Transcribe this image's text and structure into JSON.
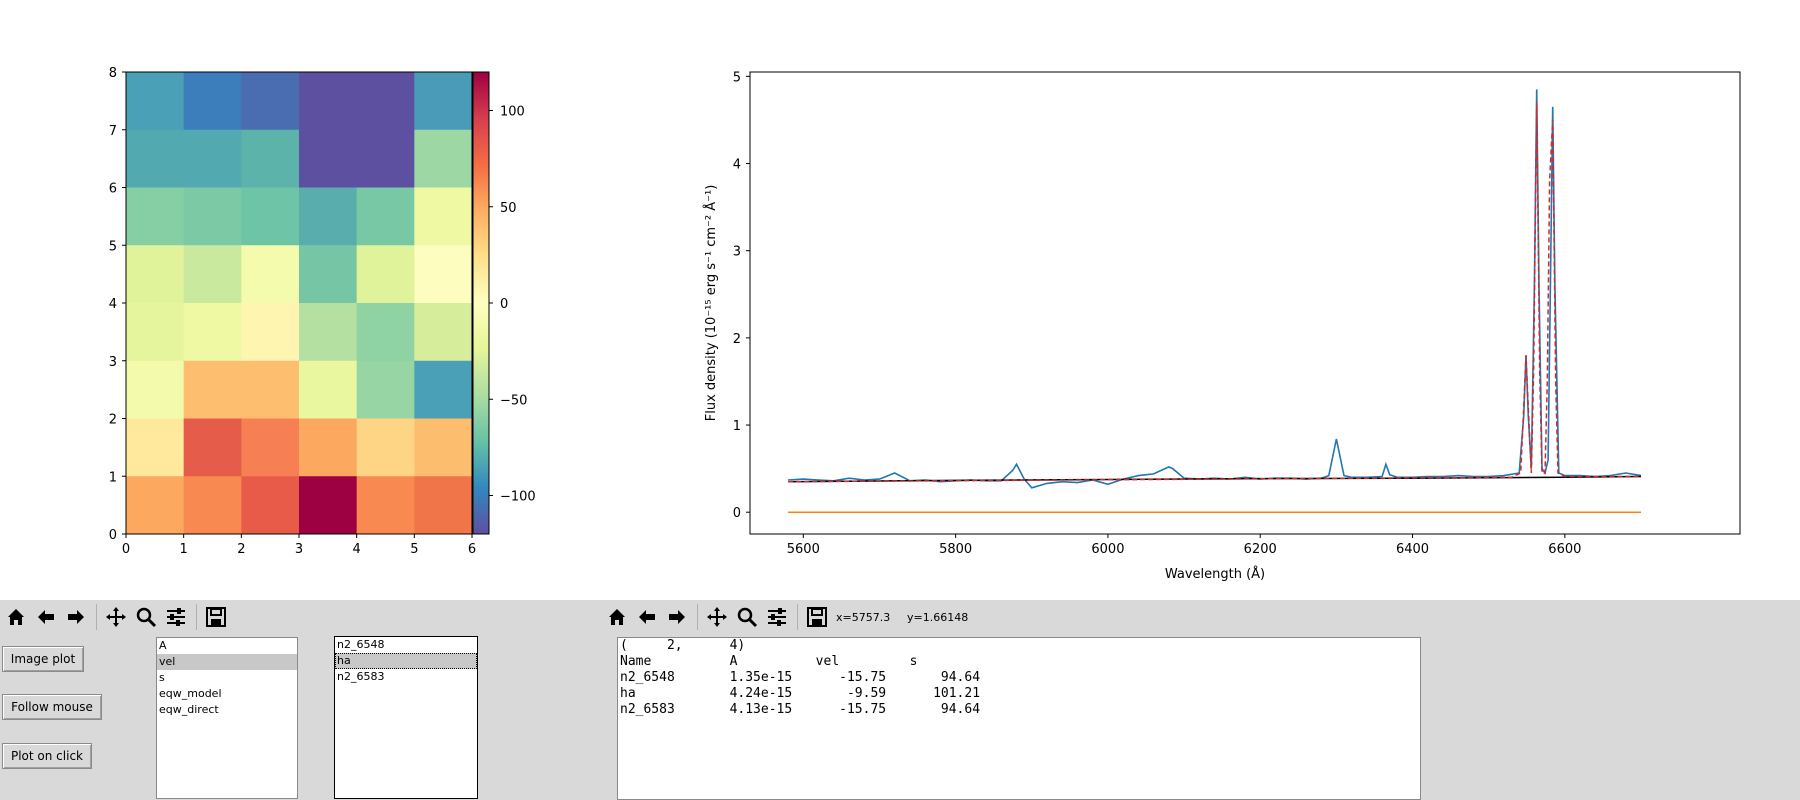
{
  "heatmap": {
    "xticks": [
      "0",
      "1",
      "2",
      "3",
      "4",
      "5",
      "6"
    ],
    "yticks": [
      "0",
      "1",
      "2",
      "3",
      "4",
      "5",
      "6",
      "7",
      "8"
    ],
    "colorbar_ticks": [
      "100",
      "50",
      "0",
      "−50",
      "−100"
    ],
    "colorbar_tick_values": [
      100,
      50,
      0,
      -50,
      -100
    ],
    "vmin": -120,
    "vmax": 120,
    "rows_top_to_bottom": [
      [
        "#4aa0b6",
        "#3b7ebb",
        "#4a6cb0",
        "#5e50a1",
        "#5e50a1",
        "#4a9bb8"
      ],
      [
        "#52a9af",
        "#52a9af",
        "#5cb3aa",
        "#5e50a1",
        "#5e50a1",
        "#9cd7a4"
      ],
      [
        "#86cfa5",
        "#7ccaa5",
        "#6ec4a6",
        "#5aadad",
        "#78c8a5",
        "#eff9a4"
      ],
      [
        "#e0f39a",
        "#c8e99e",
        "#f5fbac",
        "#76c6a5",
        "#e0f39a",
        "#fcfdbf"
      ],
      [
        "#e5f59e",
        "#eff9a4",
        "#fef5b0",
        "#b4e1a2",
        "#8fd3a4",
        "#d6ee9b"
      ],
      [
        "#f3faac",
        "#fdbe70",
        "#fdbe70",
        "#e9f79e",
        "#97d6a4",
        "#4aa0b6"
      ],
      [
        "#fee99d",
        "#e55d4a",
        "#f67f53",
        "#fca85e",
        "#fed585",
        "#fdbd6f"
      ],
      [
        "#fca85e",
        "#f88950",
        "#e85b48",
        "#9e0142",
        "#f88950",
        "#f07548"
      ]
    ]
  },
  "spectrum": {
    "xlabel": "Wavelength (Å)",
    "ylabel": "Flux density (10⁻¹⁵ erg s⁻¹ cm⁻² Å⁻¹)",
    "xticks": [
      "5600",
      "5800",
      "6000",
      "6200",
      "6400",
      "6600"
    ],
    "yticks": [
      "0",
      "1",
      "2",
      "3",
      "4",
      "5"
    ],
    "chart_data": {
      "type": "line",
      "xlabel": "Wavelength (Å)",
      "ylabel": "Flux density (10⁻¹⁵ erg s⁻¹ cm⁻² Å⁻¹)",
      "xlim": [
        5530,
        6830
      ],
      "ylim": [
        -0.25,
        5.05
      ],
      "series": [
        {
          "style": "observed",
          "color": "#1f77b4",
          "x": [
            5580,
            5600,
            5620,
            5640,
            5660,
            5680,
            5700,
            5720,
            5740,
            5760,
            5780,
            5800,
            5820,
            5840,
            5860,
            5875,
            5880,
            5890,
            5900,
            5920,
            5940,
            5960,
            5980,
            6000,
            6020,
            6040,
            6060,
            6080,
            6085,
            6100,
            6120,
            6140,
            6160,
            6180,
            6200,
            6220,
            6240,
            6260,
            6280,
            6290,
            6300,
            6310,
            6320,
            6340,
            6360,
            6365,
            6370,
            6380,
            6400,
            6420,
            6440,
            6460,
            6480,
            6500,
            6520,
            6540,
            6546,
            6549,
            6552,
            6556,
            6560,
            6563,
            6566,
            6570,
            6574,
            6578,
            6581,
            6584,
            6587,
            6592,
            6600,
            6620,
            6640,
            6660,
            6680,
            6700
          ],
          "y": [
            0.37,
            0.38,
            0.37,
            0.36,
            0.39,
            0.37,
            0.38,
            0.45,
            0.36,
            0.37,
            0.35,
            0.36,
            0.37,
            0.36,
            0.36,
            0.48,
            0.55,
            0.38,
            0.28,
            0.33,
            0.35,
            0.34,
            0.37,
            0.32,
            0.38,
            0.42,
            0.44,
            0.52,
            0.5,
            0.39,
            0.38,
            0.39,
            0.38,
            0.4,
            0.38,
            0.39,
            0.39,
            0.38,
            0.39,
            0.42,
            0.84,
            0.42,
            0.4,
            0.4,
            0.41,
            0.55,
            0.43,
            0.4,
            0.4,
            0.41,
            0.41,
            0.42,
            0.41,
            0.41,
            0.42,
            0.45,
            1.1,
            1.8,
            1.1,
            0.5,
            2.6,
            4.85,
            2.6,
            0.5,
            0.45,
            0.6,
            2.6,
            4.65,
            2.6,
            0.45,
            0.42,
            0.42,
            0.41,
            0.42,
            0.45,
            0.42
          ]
        },
        {
          "style": "continuum",
          "color": "#000000",
          "x": [
            5580,
            5800,
            6000,
            6200,
            6400,
            6600,
            6700
          ],
          "y": [
            0.35,
            0.365,
            0.375,
            0.385,
            0.39,
            0.4,
            0.41
          ]
        },
        {
          "style": "model",
          "color": "#d62728",
          "x": [
            5580,
            6530,
            6542,
            6546,
            6549,
            6552,
            6556,
            6559,
            6563,
            6567,
            6570,
            6574,
            6577,
            6580,
            6584,
            6588,
            6591,
            6600,
            6700
          ],
          "y": [
            0.35,
            0.4,
            0.45,
            1.2,
            1.8,
            1.2,
            0.45,
            1.6,
            4.7,
            1.6,
            0.45,
            0.45,
            1.5,
            3.8,
            4.5,
            1.5,
            0.45,
            0.41,
            0.41
          ]
        },
        {
          "style": "zero",
          "color": "#ff7f0e",
          "x": [
            5580,
            6700
          ],
          "y": [
            0,
            0
          ]
        }
      ]
    }
  },
  "toolbar_left": {
    "buttons": [
      "home-icon",
      "back-arrow-icon",
      "forward-arrow-icon",
      "pan-icon",
      "zoom-icon",
      "configure-icon",
      "save-icon"
    ]
  },
  "toolbar_right": {
    "buttons": [
      "home-icon",
      "back-arrow-icon",
      "forward-arrow-icon",
      "pan-icon",
      "zoom-icon",
      "configure-icon",
      "save-icon"
    ],
    "x_readout": "x=5757.3",
    "y_readout": "y=1.66148"
  },
  "controls": {
    "image_plot": "Image plot",
    "follow_mouse": "Follow mouse",
    "plot_on_click": "Plot on click"
  },
  "param_list": {
    "items": [
      "A",
      "vel",
      "s",
      "eqw_model",
      "eqw_direct"
    ],
    "selected_index": 1
  },
  "line_list": {
    "items": [
      "n2_6548",
      "ha",
      "n2_6583"
    ],
    "selected_index": 1
  },
  "results": {
    "lines": [
      "(     2,      4)",
      "Name          A          vel         s",
      "n2_6548       1.35e-15      -15.75       94.64",
      "ha            4.24e-15       -9.59      101.21",
      "n2_6583       4.13e-15      -15.75       94.64"
    ]
  }
}
